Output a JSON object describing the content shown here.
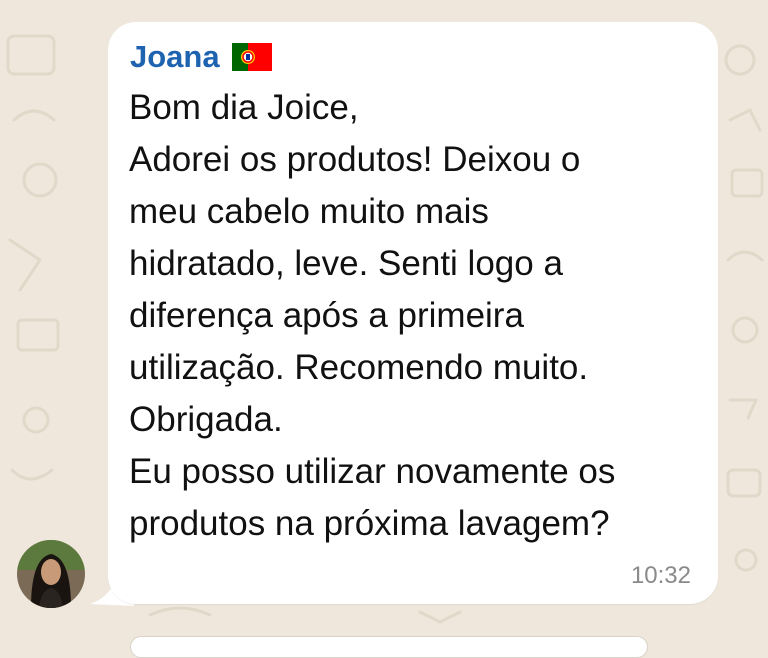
{
  "chat": {
    "sender": {
      "name": "Joana",
      "flag_icon": "portugal-flag-icon",
      "name_color": "#1e63b0"
    },
    "message": {
      "lines": [
        "Bom dia Joice,",
        "Adorei os produtos! Deixou o",
        "meu cabelo muito mais",
        "hidratado, leve. Senti logo a",
        "diferença após a primeira",
        "utilização. Recomendo muito.",
        "Obrigada.",
        "Eu posso utilizar novamente os",
        "produtos na próxima lavagem?"
      ],
      "time": "10:32"
    },
    "avatar_icon": "profile-photo-avatar",
    "colors": {
      "wallpaper": "#efe7dc",
      "bubble": "#ffffff",
      "text": "#111111",
      "time": "#8a8a8a"
    }
  }
}
